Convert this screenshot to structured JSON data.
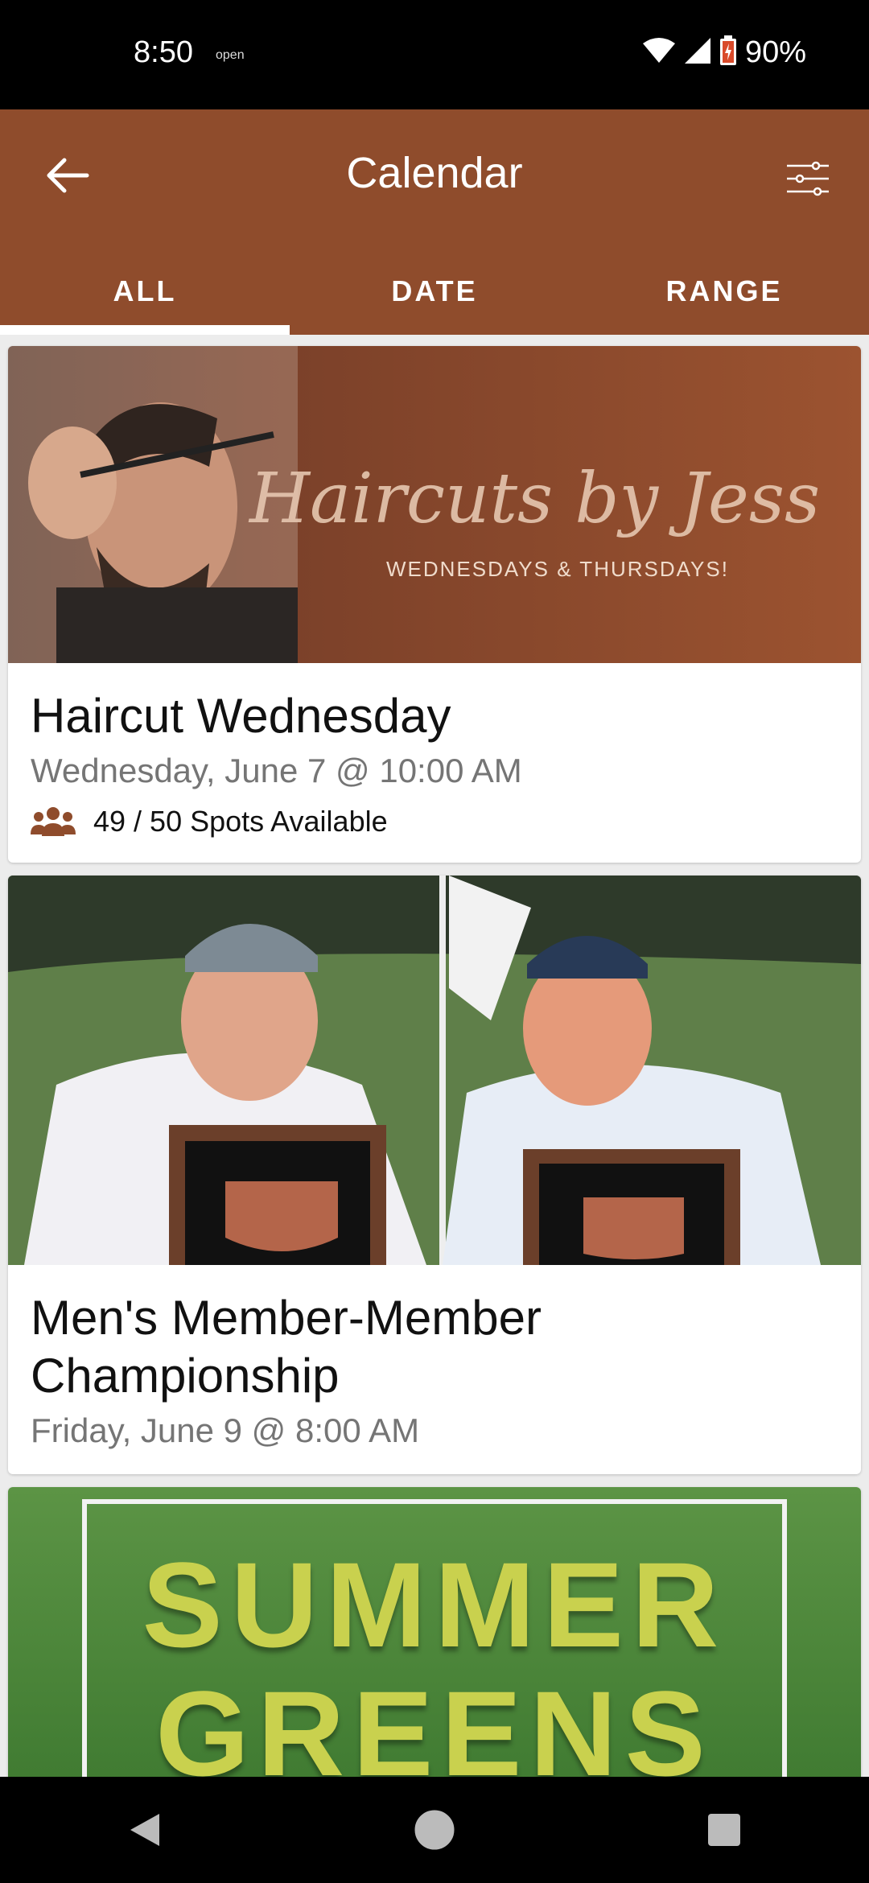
{
  "status": {
    "time": "8:50",
    "open_label": "open",
    "battery": "90%"
  },
  "header": {
    "title": "Calendar"
  },
  "tabs": [
    {
      "label": "ALL",
      "active": true
    },
    {
      "label": "DATE",
      "active": false
    },
    {
      "label": "RANGE",
      "active": false
    }
  ],
  "events": [
    {
      "banner_title": "Haircuts by Jess",
      "banner_sub": "WEDNESDAYS & THURSDAYS!",
      "title": "Haircut Wednesday",
      "date": "Wednesday, June 7 @ 10:00 AM",
      "spots": "49 / 50 Spots Available"
    },
    {
      "title": "Men's Member-Member Championship",
      "date": "Friday, June 9 @ 8:00 AM"
    },
    {
      "banner_line1": "SUMMER",
      "banner_line2": "GREENS"
    }
  ],
  "colors": {
    "brand": "#8f4c2c",
    "brand_dark": "#7a3f23",
    "text_muted": "#757575"
  }
}
